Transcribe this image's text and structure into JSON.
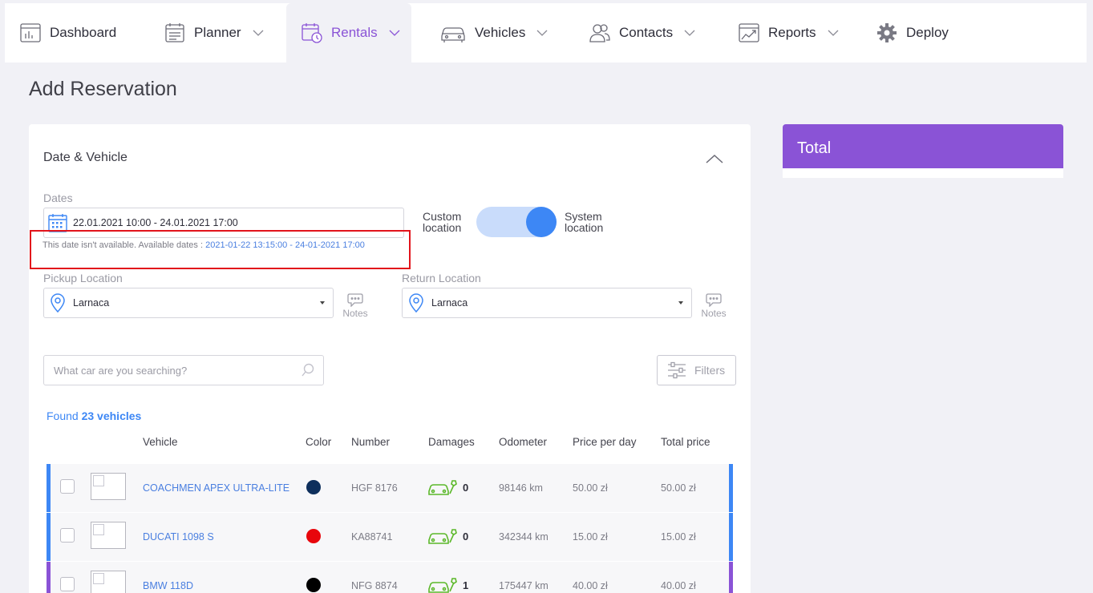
{
  "nav": {
    "items": [
      {
        "label": "Dashboard",
        "icon": "dashboard-icon",
        "has_chevron": false
      },
      {
        "label": "Planner",
        "icon": "planner-icon",
        "has_chevron": true
      },
      {
        "label": "Rentals",
        "icon": "rentals-calendar-icon",
        "has_chevron": true,
        "active": true
      },
      {
        "label": "Vehicles",
        "icon": "car-icon",
        "has_chevron": true
      },
      {
        "label": "Contacts",
        "icon": "contacts-icon",
        "has_chevron": true
      },
      {
        "label": "Reports",
        "icon": "reports-icon",
        "has_chevron": true
      },
      {
        "label": "Deploy",
        "icon": "gear-icon",
        "has_chevron": false
      }
    ]
  },
  "page": {
    "title": "Add Reservation"
  },
  "section": {
    "title": "Date & Vehicle"
  },
  "dates": {
    "label": "Dates",
    "value": "22.01.2021 10:00 - 24.01.2021 17:00",
    "warning": "This date isn't available. Available dates :",
    "available_range": "2021-01-22 13:15:00 - 24-01-2021 17:00"
  },
  "location_toggle": {
    "left_label_1": "Custom",
    "left_label_2": "location",
    "right_label_1": "System",
    "right_label_2": "location",
    "state": "system"
  },
  "pickup": {
    "label": "Pickup Location",
    "value": "Larnaca",
    "notes_label": "Notes"
  },
  "return": {
    "label": "Return Location",
    "value": "Larnaca",
    "notes_label": "Notes"
  },
  "search": {
    "placeholder": "What car are you searching?"
  },
  "filters": {
    "label": "Filters"
  },
  "found": {
    "prefix": "Found",
    "count_text": "23 vehicles"
  },
  "table": {
    "headers": {
      "vehicle": "Vehicle",
      "color": "Color",
      "number": "Number",
      "damages": "Damages",
      "odometer": "Odometer",
      "price_per_day": "Price per day",
      "total_price": "Total price"
    },
    "rows": [
      {
        "name": "COACHMEN APEX ULTRA-LITE",
        "color": "#0e2f5c",
        "number": "HGF 8176",
        "damages": "0",
        "odometer": "98146 km",
        "price_per_day": "50.00 zł",
        "total_price": "50.00 zł",
        "accent": "#3d87f5"
      },
      {
        "name": "DUCATI 1098 S",
        "color": "#e8060c",
        "number": "KA88741",
        "damages": "0",
        "odometer": "342344 km",
        "price_per_day": "15.00 zł",
        "total_price": "15.00 zł",
        "accent": "#3d87f5"
      },
      {
        "name": "BMW 118D",
        "color": "#000000",
        "number": "NFG 8874",
        "damages": "1",
        "odometer": "175447 km",
        "price_per_day": "40.00 zł",
        "total_price": "40.00 zł",
        "accent": "#8a53d6"
      }
    ]
  },
  "total": {
    "title": "Total"
  },
  "colors": {
    "accent_purple": "#8a53d6",
    "accent_blue": "#3d87f5",
    "warning_red": "#e2141b",
    "damage_green": "#5cb82a"
  }
}
